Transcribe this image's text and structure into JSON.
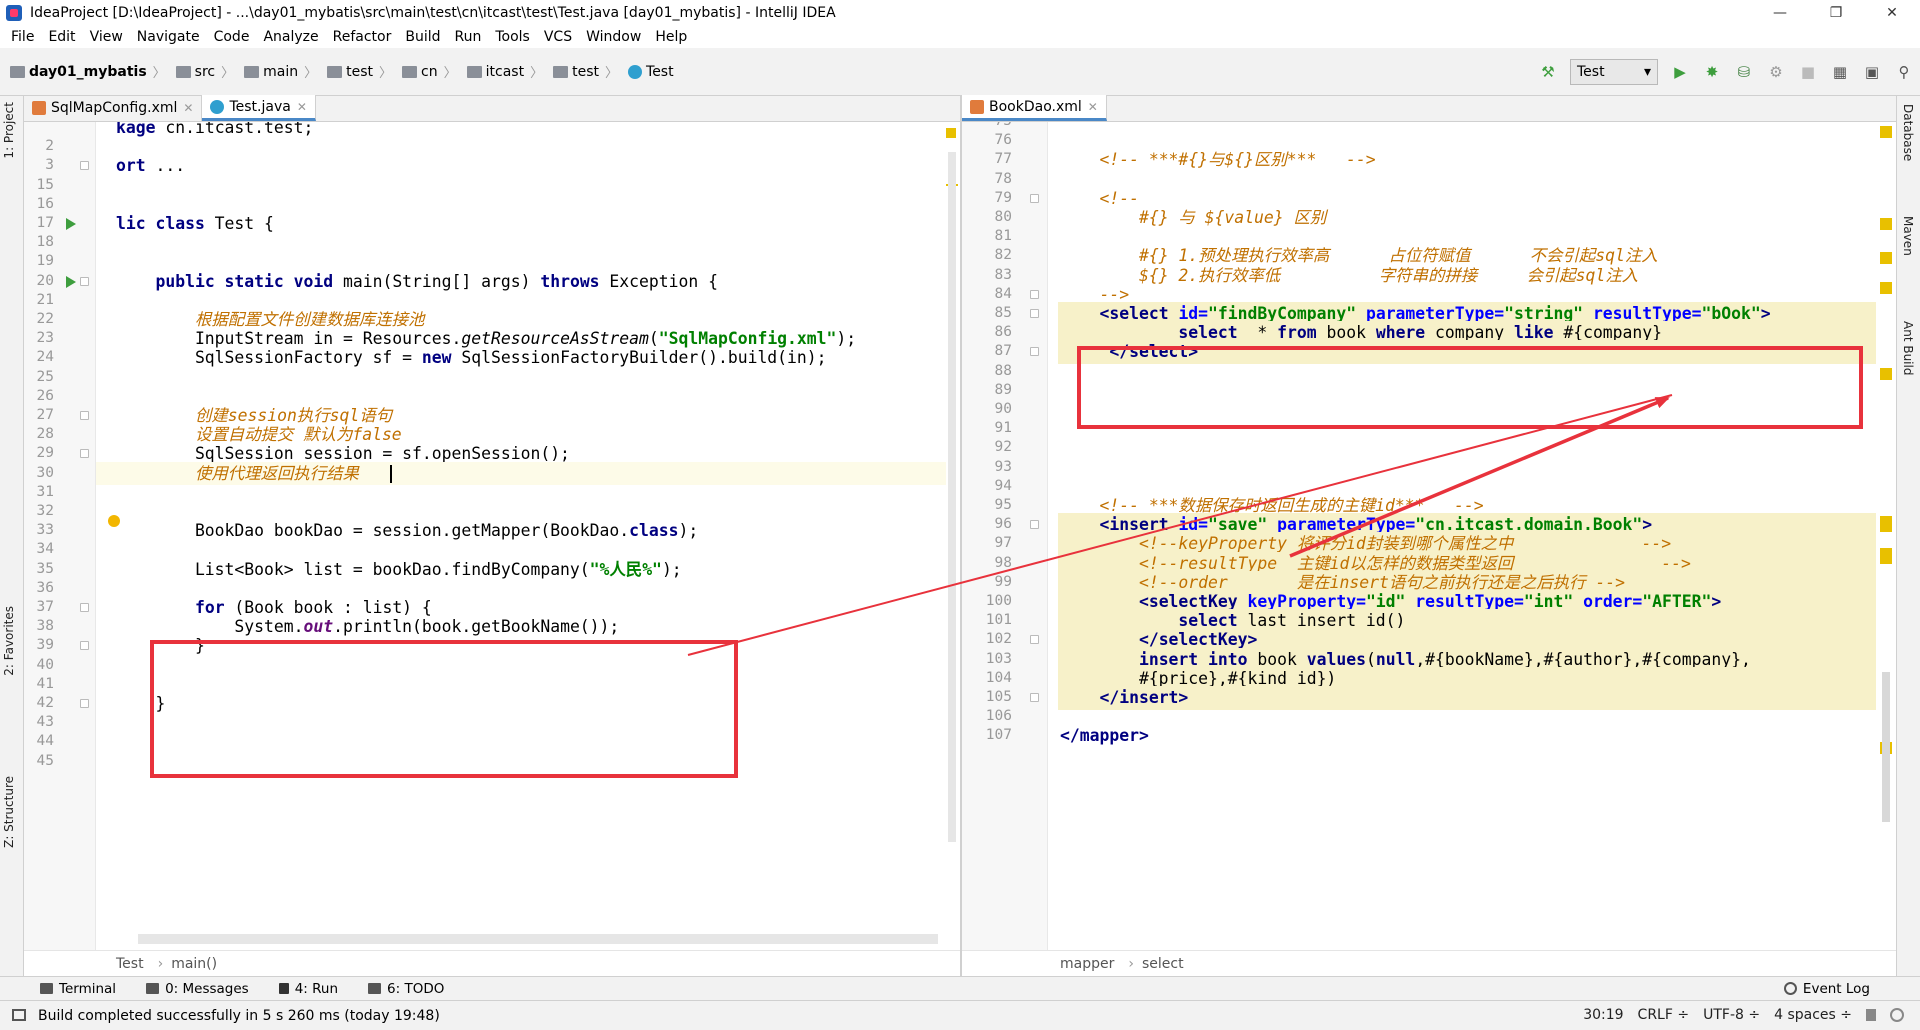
{
  "window": {
    "title": "IdeaProject [D:\\IdeaProject] - ...\\day01_mybatis\\src\\main\\test\\cn\\itcast\\test\\Test.java [day01_mybatis] - IntelliJ IDEA",
    "minimize": "—",
    "maximize": "❐",
    "close": "✕"
  },
  "menu": [
    "File",
    "Edit",
    "View",
    "Navigate",
    "Code",
    "Analyze",
    "Refactor",
    "Build",
    "Run",
    "Tools",
    "VCS",
    "Window",
    "Help"
  ],
  "breadcrumb": [
    "day01_mybatis",
    "src",
    "main",
    "test",
    "cn",
    "itcast",
    "test",
    "Test"
  ],
  "toolbar": {
    "run_config": "Test",
    "run_config_arrow": "▾"
  },
  "left_strip": {
    "project": "1: Project",
    "favorites": "2: Favorites",
    "structure": "Z: Structure"
  },
  "right_strip": {
    "database": "Database",
    "maven": "Maven",
    "ant": "Ant Build"
  },
  "left_tabs": [
    {
      "label": "SqlMapConfig.xml",
      "active": false
    },
    {
      "label": "Test.java",
      "active": true
    }
  ],
  "right_tabs": [
    {
      "label": "BookDao.xml",
      "active": true
    }
  ],
  "left_editor": {
    "lines": [
      {
        "n": "",
        "html": "<span class=\"kw\">kage</span> cn.itcast.test;"
      },
      {
        "n": "2",
        "html": ""
      },
      {
        "n": "3",
        "html": "<span class=\"kw\">ort</span> ..."
      },
      {
        "n": "15",
        "html": ""
      },
      {
        "n": "16",
        "html": ""
      },
      {
        "n": "17",
        "html": "<span class=\"kw\">lic class</span> Test {"
      },
      {
        "n": "18",
        "html": ""
      },
      {
        "n": "19",
        "html": ""
      },
      {
        "n": "20",
        "html": "    <span class=\"kw\">public static void</span> main(String[] args) <span class=\"kw\">throws</span> Exception {"
      },
      {
        "n": "21",
        "html": ""
      },
      {
        "n": "22",
        "html": "        <span class=\"cm\">根据配置文件创建数据库连接池</span>"
      },
      {
        "n": "23",
        "html": "        InputStream in = Resources.<span class=\"it\">getResourceAsStream</span>(<span class=\"str\">\"SqlMapConfig.xml\"</span>);"
      },
      {
        "n": "24",
        "html": "        SqlSessionFactory sf = <span class=\"kw\">new</span> SqlSessionFactoryBuilder().build(in);"
      },
      {
        "n": "25",
        "html": ""
      },
      {
        "n": "26",
        "html": ""
      },
      {
        "n": "27",
        "html": "        <span class=\"cm\">创建session执行sql语句</span>"
      },
      {
        "n": "28",
        "html": "        <span class=\"cm\">设置自动提交 默认为false</span>"
      },
      {
        "n": "29",
        "html": "        SqlSession session = sf.openSession();"
      },
      {
        "n": "30",
        "html": "        <span class=\"cm\">使用代理返回执行结果</span>"
      },
      {
        "n": "31",
        "html": ""
      },
      {
        "n": "32",
        "html": ""
      },
      {
        "n": "33",
        "html": "        BookDao bookDao = session.getMapper(BookDao.<span class=\"kw\">class</span>);"
      },
      {
        "n": "34",
        "html": ""
      },
      {
        "n": "35",
        "html": "        List&lt;Book&gt; list = bookDao.findByCompany(<span class=\"str\">\"%人民%\"</span>);"
      },
      {
        "n": "36",
        "html": ""
      },
      {
        "n": "37",
        "html": "        <span class=\"kw\">for</span> (Book book : list) {"
      },
      {
        "n": "38",
        "html": "            System.<span class=\"fld\">out</span>.println(book.getBookName());"
      },
      {
        "n": "39",
        "html": "        }"
      },
      {
        "n": "40",
        "html": ""
      },
      {
        "n": "41",
        "html": ""
      },
      {
        "n": "42",
        "html": "    }"
      },
      {
        "n": "43",
        "html": ""
      },
      {
        "n": "44",
        "html": ""
      },
      {
        "n": "45",
        "html": ""
      }
    ],
    "breadcrumb": [
      "Test",
      "main()"
    ]
  },
  "right_editor": {
    "lines": [
      {
        "n": "75",
        "html": ""
      },
      {
        "n": "76",
        "html": ""
      },
      {
        "n": "77",
        "html": "    <span class=\"xcm\">&lt;!-- ***#{}与${}区别***   --&gt;</span>"
      },
      {
        "n": "78",
        "html": ""
      },
      {
        "n": "79",
        "html": "    <span class=\"xcm\">&lt;!--</span>"
      },
      {
        "n": "80",
        "html": "        <span class=\"xcm\">#{} 与 ${value} 区别</span>"
      },
      {
        "n": "81",
        "html": ""
      },
      {
        "n": "82",
        "html": "        <span class=\"xcm\">#{} 1.预处理执行效率高      占位符赋值      不会引起sql注入</span>"
      },
      {
        "n": "83",
        "html": "        <span class=\"xcm\">${} 2.执行效率低          字符串的拼接     会引起sql注入</span>"
      },
      {
        "n": "84",
        "html": "    <span class=\"xcm\">--&gt;</span>"
      },
      {
        "n": "85",
        "html": "    <span class=\"tag\">&lt;select</span> <span class=\"attr\">id=</span><span class=\"aval\">\"findByCompany\"</span> <span class=\"attr\">parameterType=</span><span class=\"aval\">\"string\"</span> <span class=\"attr\">resultType=</span><span class=\"aval\">\"bOok\"</span><span class=\"tag\">&gt;</span>"
      },
      {
        "n": "86",
        "html": "            <span class=\"kw\">select</span>  * <span class=\"kw\">from</span> book <span class=\"kw\">where</span> company <span class=\"kw\">like</span> #{company}"
      },
      {
        "n": "87",
        "html": "     <span class=\"tag\">&lt;/select&gt;</span>"
      },
      {
        "n": "88",
        "html": ""
      },
      {
        "n": "89",
        "html": ""
      },
      {
        "n": "90",
        "html": ""
      },
      {
        "n": "91",
        "html": ""
      },
      {
        "n": "92",
        "html": ""
      },
      {
        "n": "93",
        "html": ""
      },
      {
        "n": "94",
        "html": ""
      },
      {
        "n": "95",
        "html": "    <span class=\"xcm\">&lt;!-- ***数据保存时返回生成的主键id***   --&gt;</span>"
      },
      {
        "n": "96",
        "html": "    <span class=\"tag\">&lt;insert</span> <span class=\"attr\">id=</span><span class=\"aval\">\"save\"</span> <span class=\"attr\">parameterType=</span><span class=\"aval\">\"cn.itcast.domain.Book\"</span><span class=\"tag\">&gt;</span>"
      },
      {
        "n": "97",
        "html": "        <span class=\"xcm\">&lt;!--keyProperty 将评分id封装到哪个属性之中             --&gt;</span>"
      },
      {
        "n": "98",
        "html": "        <span class=\"xcm\">&lt;!--resultType  主键id以怎样的数据类型返回               --&gt;</span>"
      },
      {
        "n": "99",
        "html": "        <span class=\"xcm\">&lt;!--order       是在insert语句之前执行还是之后执行 --&gt;</span>"
      },
      {
        "n": "100",
        "html": "        <span class=\"tag\">&lt;selectKey</span> <span class=\"attr\">keyProperty=</span><span class=\"aval\">\"id\"</span> <span class=\"attr\">resultType=</span><span class=\"aval\">\"int\"</span> <span class=\"attr\">order=</span><span class=\"aval\">\"AFTER\"</span><span class=\"tag\">&gt;</span>"
      },
      {
        "n": "101",
        "html": "            <span class=\"kw\">select</span> last_insert_id()"
      },
      {
        "n": "102",
        "html": "        <span class=\"tag\">&lt;/selectKey&gt;</span>"
      },
      {
        "n": "103",
        "html": "        <span class=\"kw\">insert into</span> book <span class=\"kw\">values</span>(<span class=\"kw\">null</span>,#{bookName},#{author},#{company},"
      },
      {
        "n": "104",
        "html": "        #{price},#{kind_id})"
      },
      {
        "n": "105",
        "html": "    <span class=\"tag\">&lt;/insert&gt;</span>"
      },
      {
        "n": "106",
        "html": ""
      },
      {
        "n": "107",
        "html": "<span class=\"tag\">&lt;/mapper&gt;</span>"
      }
    ],
    "breadcrumb": [
      "mapper",
      "select"
    ]
  },
  "tool_tabs": [
    "Terminal",
    "0: Messages",
    "4: Run",
    "6: TODO"
  ],
  "event_log": "Event Log",
  "status": {
    "message": "Build completed successfully in 5 s 260 ms (today 19:48)",
    "position": "30:19",
    "line_sep": "CRLF ÷",
    "encoding": "UTF-8 ÷",
    "indent": "4 spaces ÷"
  },
  "colors": {
    "annotation_red": "#e8323c",
    "keyword": "#000080",
    "string": "#008000",
    "comment": "#c07000"
  }
}
